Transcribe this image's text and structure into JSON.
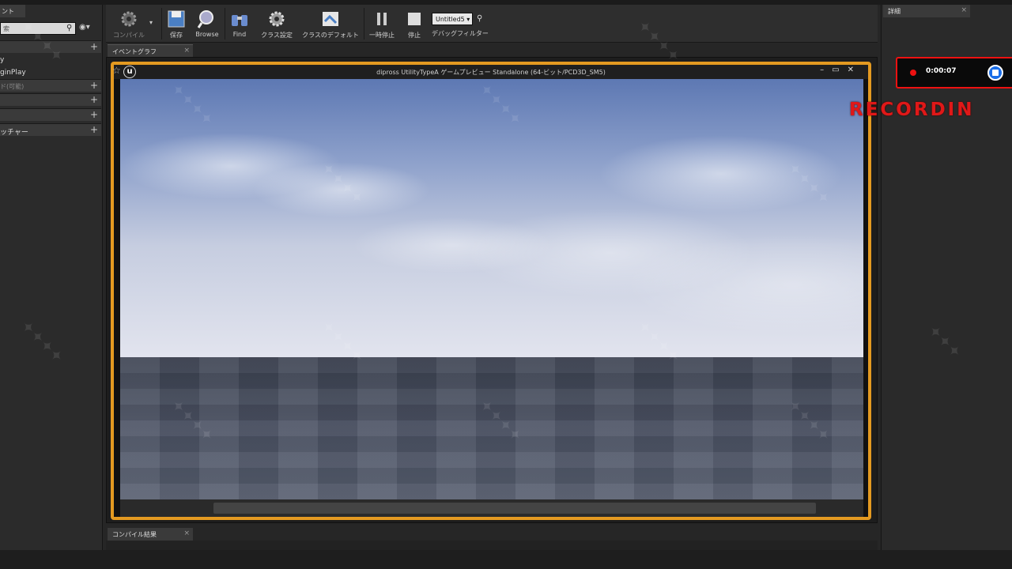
{
  "left_panel": {
    "tab_label": "ント",
    "search_placeholder": "索",
    "rows": [
      {
        "label": "y",
        "type": "plain"
      },
      {
        "label": "ginPlay",
        "type": "plain"
      },
      {
        "label": "ド(可能)",
        "type": "dim"
      },
      {
        "label": "",
        "type": "header"
      },
      {
        "label": "",
        "type": "header"
      },
      {
        "label": "ッチャー",
        "type": "header"
      }
    ]
  },
  "toolbar": {
    "compile_label": "コンパイル",
    "save_label": "保存",
    "browse_label": "Browse",
    "find_label": "Find",
    "class_settings_label": "クラス設定",
    "class_defaults_label": "クラスのデフォルト",
    "pause_label": "一時停止",
    "stop_label": "停止",
    "debug_select_value": "Untitled5",
    "debug_filter_label": "デバッグフィルター"
  },
  "graph_tab": {
    "label": "イベントグラフ"
  },
  "preview": {
    "title": "dipross UtilityTypeA ゲームプレビュー Standalone (64-ビット/PCD3D_SM5)"
  },
  "compile_tab": {
    "label": "コンパイル結果"
  },
  "right_panel": {
    "tab_label": "詳細"
  },
  "recording": {
    "time": "0:00:07",
    "label": "RECORDIN"
  }
}
